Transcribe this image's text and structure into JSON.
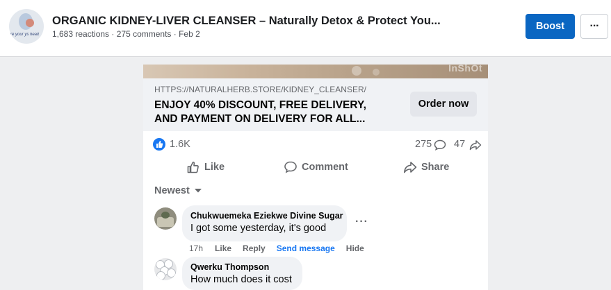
{
  "post": {
    "title": "ORGANIC KIDNEY-LIVER CLEANSER – Naturally Detox & Protect You...",
    "meta": "1,683 reactions · 275 comments · Feb 2",
    "avatar_icon": "page-logo-icon",
    "avatar_text": "re your ys healt"
  },
  "toolbar": {
    "boost_label": "Boost",
    "more_label": "···"
  },
  "media": {
    "watermark": "InShOt"
  },
  "link": {
    "url": "HTTPS://NATURALHERB.STORE/KIDNEY_CLEANSER/",
    "headline": "ENJOY 40% DISCOUNT, FREE DELIVERY, AND PAYMENT ON DELIVERY FOR ALL...",
    "cta_label": "Order now"
  },
  "stats": {
    "likes": "1.6K",
    "comments": "275",
    "shares": "47"
  },
  "actions": {
    "like": "Like",
    "comment": "Comment",
    "share": "Share"
  },
  "comments_sort": "Newest",
  "comments": [
    {
      "author": "Chukwuemeka Eziekwe Divine Sugar",
      "text": "I got some yesterday, it's good",
      "time": "17h",
      "like": "Like",
      "reply": "Reply",
      "send": "Send message",
      "hide": "Hide"
    },
    {
      "author": "Qwerku Thompson",
      "text": "How much does it cost"
    }
  ],
  "colors": {
    "accent": "#0a66c2",
    "facebook_blue": "#1877f2",
    "secondary_text": "#65676b"
  }
}
